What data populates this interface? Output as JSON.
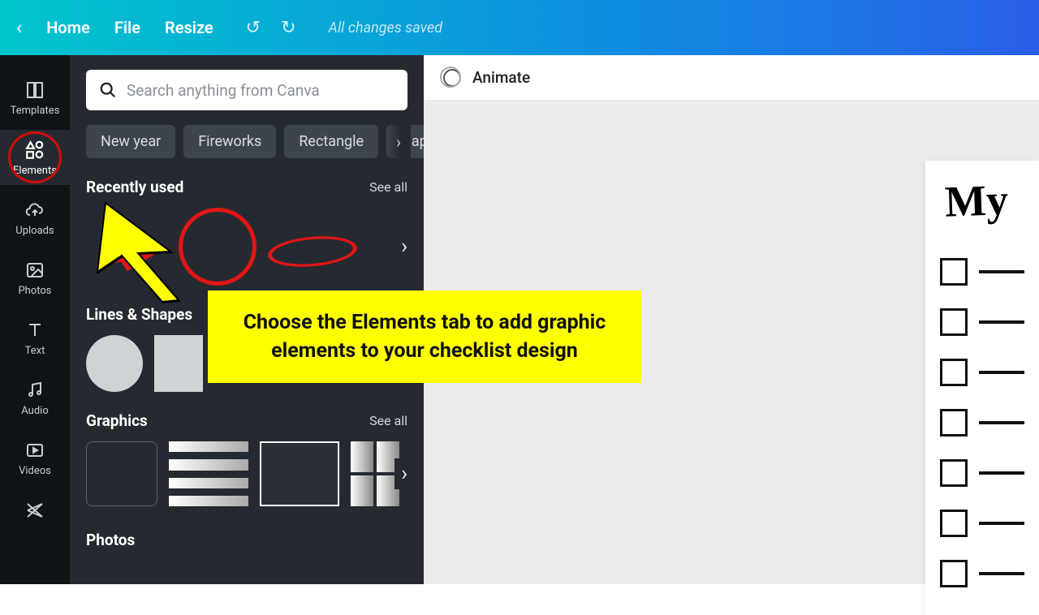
{
  "topbar": {
    "home": "Home",
    "file": "File",
    "resize": "Resize",
    "status": "All changes saved"
  },
  "rail": {
    "templates": "Templates",
    "elements": "Elements",
    "uploads": "Uploads",
    "photos": "Photos",
    "text": "Text",
    "audio": "Audio",
    "videos": "Videos"
  },
  "search": {
    "placeholder": "Search anything from Canva"
  },
  "chips": [
    "New year",
    "Fireworks",
    "Rectangle",
    "Happ"
  ],
  "sections": {
    "recent": {
      "title": "Recently used",
      "seeall": "See all"
    },
    "lines": {
      "title": "Lines & Shapes"
    },
    "graphics": {
      "title": "Graphics",
      "seeall": "See all"
    },
    "photos": {
      "title": "Photos"
    }
  },
  "toolbar": {
    "animate": "Animate"
  },
  "page": {
    "title": "My"
  },
  "tooltip": "Choose the Elements tab to add graphic elements to your checklist design"
}
